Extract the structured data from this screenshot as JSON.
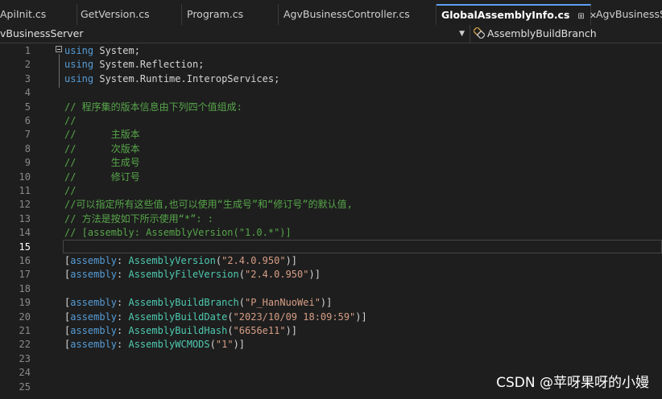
{
  "tabs": [
    {
      "label": "ApiInit.cs",
      "active": false
    },
    {
      "label": "GetVersion.cs",
      "active": false
    },
    {
      "label": "Program.cs",
      "active": false
    },
    {
      "label": "AgvBusinessController.cs",
      "active": false
    },
    {
      "label": "GlobalAssemblyInfo.cs",
      "active": true,
      "pin_icon": "pin-icon",
      "close_icon": "close-icon"
    },
    {
      "label": "AgvBusinessSe",
      "active": false
    }
  ],
  "nav": {
    "project": "vBusinessServer",
    "member": "AssemblyBuildBranch",
    "member_icon": "attribute-class-icon"
  },
  "editor": {
    "current_line": 15,
    "lines": [
      {
        "n": "1",
        "tokens": [
          {
            "t": "kw",
            "v": "using"
          },
          {
            "t": "ns",
            "v": " System;"
          }
        ]
      },
      {
        "n": "2",
        "tokens": [
          {
            "t": "kw",
            "v": "using"
          },
          {
            "t": "ns",
            "v": " System.Reflection;"
          }
        ]
      },
      {
        "n": "3",
        "tokens": [
          {
            "t": "kw",
            "v": "using"
          },
          {
            "t": "ns",
            "v": " System.Runtime.InteropServices;"
          }
        ]
      },
      {
        "n": "4",
        "tokens": []
      },
      {
        "n": "5",
        "tokens": [
          {
            "t": "cm",
            "v": "// 程序集的版本信息由下列四个值组成:"
          }
        ]
      },
      {
        "n": "6",
        "tokens": [
          {
            "t": "cm",
            "v": "//"
          }
        ]
      },
      {
        "n": "7",
        "tokens": [
          {
            "t": "cm",
            "v": "//      主版本"
          }
        ]
      },
      {
        "n": "8",
        "tokens": [
          {
            "t": "cm",
            "v": "//      次版本"
          }
        ]
      },
      {
        "n": "9",
        "tokens": [
          {
            "t": "cm",
            "v": "//      生成号"
          }
        ]
      },
      {
        "n": "10",
        "tokens": [
          {
            "t": "cm",
            "v": "//      修订号"
          }
        ]
      },
      {
        "n": "11",
        "tokens": [
          {
            "t": "cm",
            "v": "//"
          }
        ]
      },
      {
        "n": "12",
        "tokens": [
          {
            "t": "cm",
            "v": "//可以指定所有这些值,也可以使用“生成号”和“修订号”的默认值,"
          }
        ]
      },
      {
        "n": "13",
        "tokens": [
          {
            "t": "cm",
            "v": "// 方法是按如下所示使用“*”: :"
          }
        ]
      },
      {
        "n": "14",
        "tokens": [
          {
            "t": "cm",
            "v": "// [assembly: AssemblyVersion(\"1.0.*\")]"
          }
        ]
      },
      {
        "n": "15",
        "tokens": []
      },
      {
        "n": "16",
        "tokens": [
          {
            "t": "pn",
            "v": "["
          },
          {
            "t": "kw",
            "v": "assembly"
          },
          {
            "t": "pn",
            "v": ": "
          },
          {
            "t": "ty",
            "v": "AssemblyVersion"
          },
          {
            "t": "pn",
            "v": "("
          },
          {
            "t": "st",
            "v": "\"2.4.0.950\""
          },
          {
            "t": "pn",
            "v": ")]"
          }
        ]
      },
      {
        "n": "17",
        "tokens": [
          {
            "t": "pn",
            "v": "["
          },
          {
            "t": "kw",
            "v": "assembly"
          },
          {
            "t": "pn",
            "v": ": "
          },
          {
            "t": "ty",
            "v": "AssemblyFileVersion"
          },
          {
            "t": "pn",
            "v": "("
          },
          {
            "t": "st",
            "v": "\"2.4.0.950\""
          },
          {
            "t": "pn",
            "v": ")]"
          }
        ]
      },
      {
        "n": "18",
        "tokens": []
      },
      {
        "n": "19",
        "tokens": [
          {
            "t": "pn",
            "v": "["
          },
          {
            "t": "kw",
            "v": "assembly"
          },
          {
            "t": "pn",
            "v": ": "
          },
          {
            "t": "ty",
            "v": "AssemblyBuildBranch"
          },
          {
            "t": "pn",
            "v": "("
          },
          {
            "t": "st",
            "v": "\"P_HanNuoWei\""
          },
          {
            "t": "pn",
            "v": ")]"
          }
        ]
      },
      {
        "n": "20",
        "tokens": [
          {
            "t": "pn",
            "v": "["
          },
          {
            "t": "kw",
            "v": "assembly"
          },
          {
            "t": "pn",
            "v": ": "
          },
          {
            "t": "ty",
            "v": "AssemblyBuildDate"
          },
          {
            "t": "pn",
            "v": "("
          },
          {
            "t": "st",
            "v": "\"2023/10/09 18:09:59\""
          },
          {
            "t": "pn",
            "v": ")]"
          }
        ]
      },
      {
        "n": "21",
        "tokens": [
          {
            "t": "pn",
            "v": "["
          },
          {
            "t": "kw",
            "v": "assembly"
          },
          {
            "t": "pn",
            "v": ": "
          },
          {
            "t": "ty",
            "v": "AssemblyBuildHash"
          },
          {
            "t": "pn",
            "v": "("
          },
          {
            "t": "st",
            "v": "\"6656e11\""
          },
          {
            "t": "pn",
            "v": ")]"
          }
        ]
      },
      {
        "n": "22",
        "tokens": [
          {
            "t": "pn",
            "v": "["
          },
          {
            "t": "kw",
            "v": "assembly"
          },
          {
            "t": "pn",
            "v": ": "
          },
          {
            "t": "ty",
            "v": "AssemblyWCMODS"
          },
          {
            "t": "pn",
            "v": "("
          },
          {
            "t": "st",
            "v": "\"1\""
          },
          {
            "t": "pn",
            "v": ")]"
          }
        ]
      },
      {
        "n": "23",
        "tokens": []
      },
      {
        "n": "24",
        "tokens": []
      },
      {
        "n": "25",
        "tokens": []
      }
    ]
  },
  "watermark": "CSDN @苹呀果呀的小嫚",
  "colors": {
    "background": "#1e1e1e",
    "keyword": "#569cd6",
    "comment": "#57a64a",
    "type": "#4ec9b0",
    "string": "#d69d85",
    "active_tab_accent": "#5f9ff4"
  }
}
